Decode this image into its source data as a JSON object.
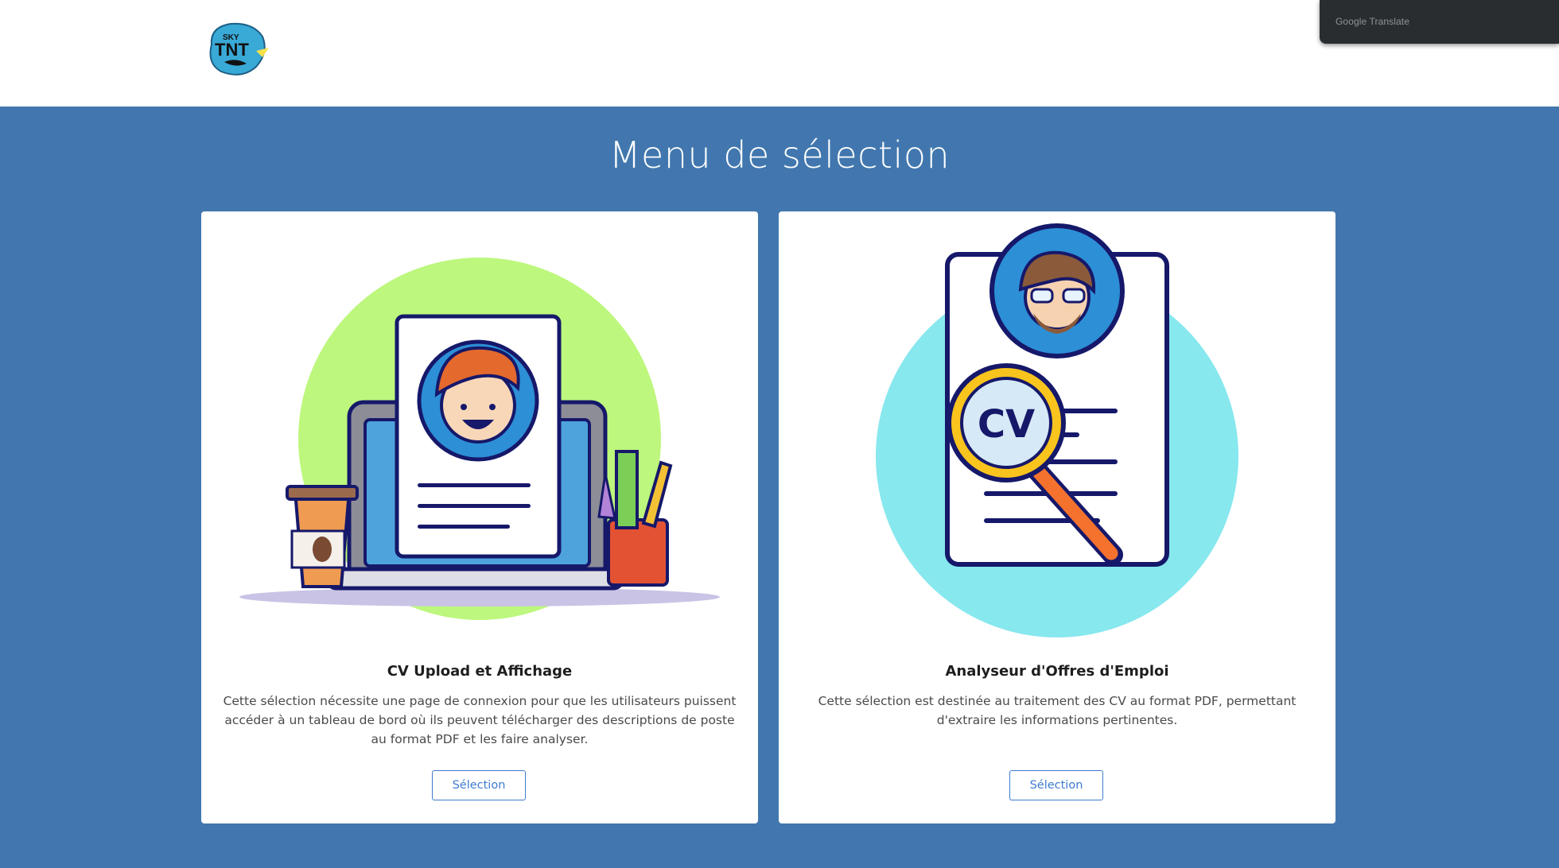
{
  "header": {
    "logo_text": "SKY TNT",
    "google_translate": "Google Translate"
  },
  "main": {
    "title": "Menu de sélection",
    "cards": [
      {
        "title": "CV Upload et Affichage",
        "description": "Cette sélection nécessite une page de connexion pour que les utilisateurs puissent accéder à un tableau de bord où ils peuvent télécharger des descriptions de poste au format PDF et les faire analyser.",
        "button_label": "Sélection",
        "illustration": "laptop-resume-icon"
      },
      {
        "title": "Analyseur d'Offres d'Emploi",
        "description": "Cette sélection est destinée au traitement des CV au format PDF, permettant d'extraire les informations pertinentes.",
        "button_label": "Sélection",
        "illustration": "cv-magnifier-icon",
        "illustration_text": "CV"
      }
    ]
  },
  "colors": {
    "main_background": "#4177ae",
    "button_accent": "#3f7bd0",
    "card_background": "#ffffff",
    "translate_bar": "#2a2d30"
  }
}
